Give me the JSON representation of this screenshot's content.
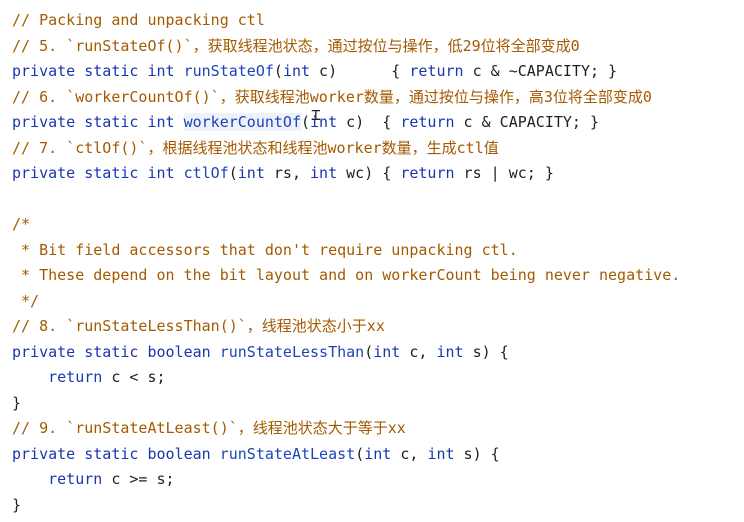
{
  "lines": [
    {
      "t": "c",
      "text": "// Packing and unpacking ctl"
    },
    {
      "t": "c",
      "text": "// 5. `runStateOf()`，获取线程池状态，通过按位与操作，低29位将全部变成0"
    },
    {
      "t": "code",
      "parts": [
        {
          "k": "kw",
          "v": "private static int "
        },
        {
          "k": "fn",
          "v": "runStateOf"
        },
        {
          "k": "tx",
          "v": "("
        },
        {
          "k": "kw",
          "v": "int"
        },
        {
          "k": "tx",
          "v": " c)      { "
        },
        {
          "k": "kw",
          "v": "return"
        },
        {
          "k": "tx",
          "v": " c & ~CAPACITY; }"
        }
      ]
    },
    {
      "t": "c",
      "text": "// 6. `workerCountOf()`，获取线程池worker数量，通过按位与操作，高3位将全部变成0"
    },
    {
      "t": "code",
      "parts": [
        {
          "k": "kw",
          "v": "private static int "
        },
        {
          "k": "fn",
          "v": "workerCountOf",
          "hl": true
        },
        {
          "k": "tx",
          "v": "("
        },
        {
          "k": "kw",
          "v": "int"
        },
        {
          "k": "tx",
          "v": " c)  { "
        },
        {
          "k": "kw",
          "v": "return"
        },
        {
          "k": "tx",
          "v": " c & CAPACITY; }"
        }
      ]
    },
    {
      "t": "c",
      "text": "// 7. `ctlOf()`，根据线程池状态和线程池worker数量，生成ctl值"
    },
    {
      "t": "code",
      "parts": [
        {
          "k": "kw",
          "v": "private static int "
        },
        {
          "k": "fn",
          "v": "ctlOf"
        },
        {
          "k": "tx",
          "v": "("
        },
        {
          "k": "kw",
          "v": "int"
        },
        {
          "k": "tx",
          "v": " rs, "
        },
        {
          "k": "kw",
          "v": "int"
        },
        {
          "k": "tx",
          "v": " wc) { "
        },
        {
          "k": "kw",
          "v": "return"
        },
        {
          "k": "tx",
          "v": " rs | wc; }"
        }
      ]
    },
    {
      "t": "blank"
    },
    {
      "t": "c",
      "text": "/*"
    },
    {
      "t": "c",
      "text": " * Bit field accessors that don't require unpacking ctl."
    },
    {
      "t": "c",
      "text": " * These depend on the bit layout and on workerCount being never negative."
    },
    {
      "t": "c",
      "text": " */"
    },
    {
      "t": "c",
      "text": "// 8. `runStateLessThan()`，线程池状态小于xx"
    },
    {
      "t": "code",
      "parts": [
        {
          "k": "kw",
          "v": "private static boolean "
        },
        {
          "k": "fn",
          "v": "runStateLessThan"
        },
        {
          "k": "tx",
          "v": "("
        },
        {
          "k": "kw",
          "v": "int"
        },
        {
          "k": "tx",
          "v": " c, "
        },
        {
          "k": "kw",
          "v": "int"
        },
        {
          "k": "tx",
          "v": " s) {"
        }
      ]
    },
    {
      "t": "code",
      "parts": [
        {
          "k": "tx",
          "v": "    "
        },
        {
          "k": "kw",
          "v": "return"
        },
        {
          "k": "tx",
          "v": " c < s;"
        }
      ]
    },
    {
      "t": "code",
      "parts": [
        {
          "k": "tx",
          "v": "}"
        }
      ]
    },
    {
      "t": "c",
      "text": "// 9. `runStateAtLeast()`，线程池状态大于等于xx"
    },
    {
      "t": "code",
      "parts": [
        {
          "k": "kw",
          "v": "private static boolean "
        },
        {
          "k": "fn",
          "v": "runStateAtLeast"
        },
        {
          "k": "tx",
          "v": "("
        },
        {
          "k": "kw",
          "v": "int"
        },
        {
          "k": "tx",
          "v": " c, "
        },
        {
          "k": "kw",
          "v": "int"
        },
        {
          "k": "tx",
          "v": " s) {"
        }
      ]
    },
    {
      "t": "code",
      "parts": [
        {
          "k": "tx",
          "v": "    "
        },
        {
          "k": "kw",
          "v": "return"
        },
        {
          "k": "tx",
          "v": " c >= s;"
        }
      ]
    },
    {
      "t": "code",
      "parts": [
        {
          "k": "tx",
          "v": "}"
        }
      ]
    }
  ],
  "colors": {
    "comment": "#a35a00",
    "keyword": "#1a35b0",
    "function": "#1c44b8",
    "text": "#1f1f1f"
  },
  "cursor_icon": "text-cursor-icon"
}
